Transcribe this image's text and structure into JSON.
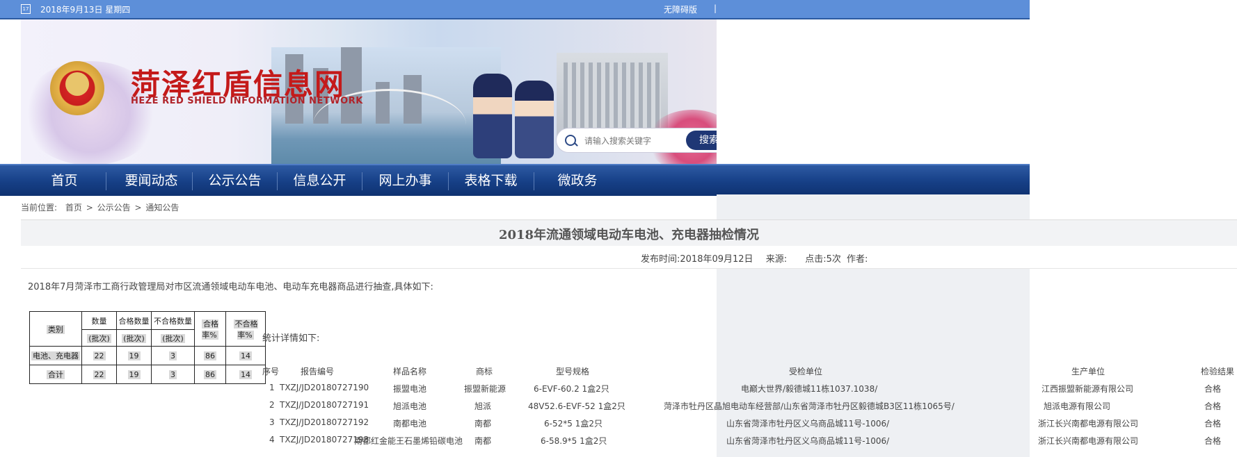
{
  "topbar": {
    "calendar_icon_text": "17",
    "date": "2018年9月13日 星期四",
    "accessibility": "无障碍版",
    "separator": "|"
  },
  "banner": {
    "title": "菏泽红盾信息网",
    "subtitle": "HEZE RED SHIELD INFORMATION NETWORK",
    "search_placeholder": "请输入搜索关键字",
    "search_button": "搜索"
  },
  "nav": [
    "首页",
    "要闻动态",
    "公示公告",
    "信息公开",
    "网上办事",
    "表格下载",
    "微政务"
  ],
  "breadcrumb": {
    "label": "当前位置:",
    "items": [
      "首页",
      "公示公告",
      "通知公告"
    ],
    "sep": ">"
  },
  "article": {
    "title": "2018年流通领域电动车电池、充电器抽检情况",
    "meta": {
      "publish": "发布时间:2018年09月12日",
      "source": "来源:",
      "clicks": "点击:5次",
      "author": "作者:"
    },
    "intro": "2018年7月菏泽市工商行政管理局对市区流通领域电动车电池、电动车充电器商品进行抽查,具体如下:",
    "detail_intro": "统计详情如下:"
  },
  "summary_table": {
    "headers": [
      "类别",
      "数量",
      "合格数量",
      "不合格数量",
      "合格率%",
      "不合格率%"
    ],
    "sub": [
      "(批次)",
      "(批次)",
      "(批次)"
    ],
    "rows": [
      [
        "电池、充电器",
        "22",
        "19",
        "3",
        "86",
        "14"
      ],
      [
        "合计",
        "22",
        "19",
        "3",
        "86",
        "14"
      ]
    ]
  },
  "detail_table": {
    "headers": [
      "序号",
      "报告编号",
      "样品名称",
      "商标",
      "型号规格",
      "受检单位",
      "生产单位",
      "检验结果"
    ],
    "rows": [
      [
        "1",
        "TXZJ/JD20180727190",
        "振盟电池",
        "振盟新能源",
        "6-EVF-60.2 1盒2只",
        "电巅大世界/毅德城11栋1037.1038/",
        "江西振盟新能源有限公司",
        "合格"
      ],
      [
        "2",
        "TXZJ/JD20180727191",
        "旭派电池",
        "旭派",
        "48V52.6-EVF-52 1盒2只",
        "菏泽市牡丹区晶旭电动车经营部/山东省菏泽市牡丹区毅德城B3区11栋1065号/",
        "旭派电源有限公司",
        "合格"
      ],
      [
        "3",
        "TXZJ/JD20180727192",
        "南都电池",
        "南都",
        "6-52*5 1盒2只",
        "山东省菏泽市牡丹区义乌商品城11号-1006/",
        "浙江长兴南都电源有限公司",
        "合格"
      ],
      [
        "4",
        "TXZJ/JD20180727193",
        "南都红金能王石墨烯铅碳电池",
        "南都",
        "6-58.9*5 1盒2只",
        "山东省菏泽市牡丹区义乌商品城11号-1006/",
        "浙江长兴南都电源有限公司",
        "合格"
      ]
    ]
  }
}
